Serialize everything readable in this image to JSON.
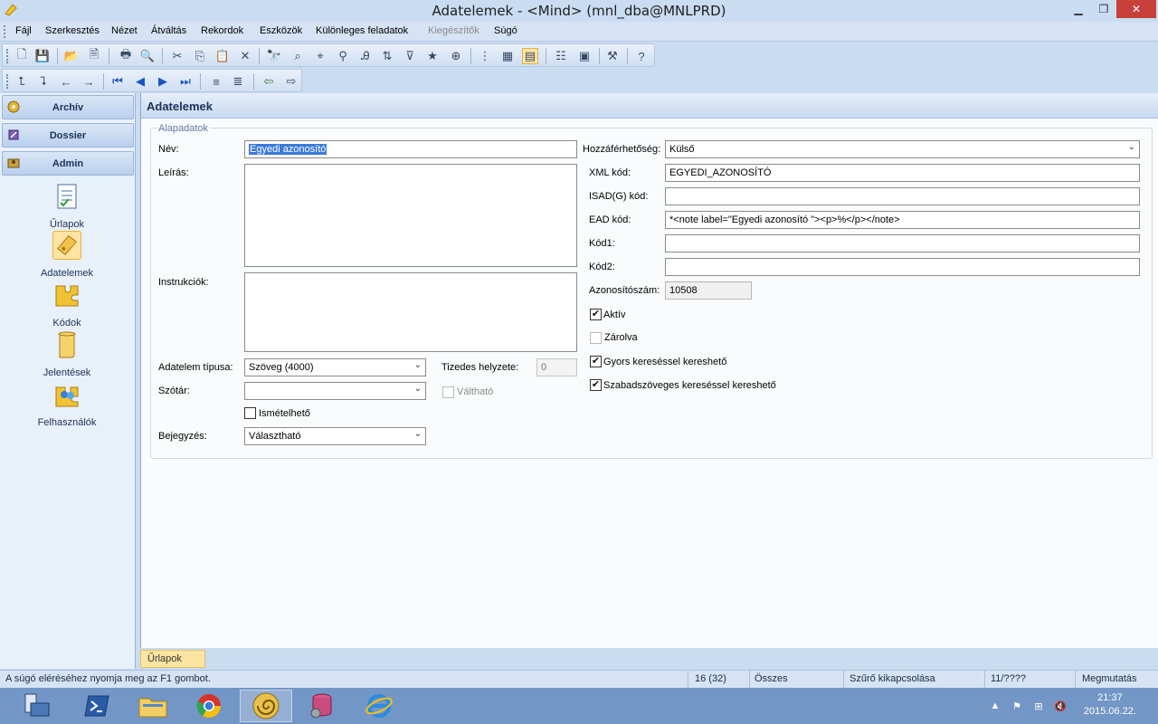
{
  "window": {
    "title": "Adatelemek - <Mind> (mnl_dba@MNLPRD)"
  },
  "menu": [
    "Fájl",
    "Szerkesztés",
    "Nézet",
    "Átváltás",
    "Rekordok",
    "Eszközök",
    "Különleges feladatok",
    "Kiegészítők",
    "Súgó"
  ],
  "nav": {
    "sections": [
      "Archív",
      "Dossier",
      "Admin"
    ],
    "items": [
      "Űrlapok",
      "Adatelemek",
      "Kódok",
      "Jelentések",
      "Felhasználók"
    ],
    "selected": "Adatelemek"
  },
  "main": {
    "header": "Adatelemek",
    "group_label": "Alapadatok",
    "form": {
      "nev_label": "Név:",
      "nev_value": "Egyedi azonosító",
      "leiras_label": "Leírás:",
      "instrukciok_label": "Instrukciók:",
      "tipus_label": "Adatelem típusa:",
      "tipus_value": "Szöveg (4000)",
      "tizedes_label": "Tizedes helyzete:",
      "tizedes_value": "0",
      "szotar_label": "Szótár:",
      "szotar_value": "",
      "valthato_label": "Váltható",
      "ismetelheto_label": "Ismételhető",
      "bejegyzes_label": "Bejegyzés:",
      "bejegyzes_value": "Választható",
      "hozzaferhetoseg_label": "Hozzáférhetőség:",
      "hozzaferhetoseg_value": "Külső",
      "xml_label": "XML kód:",
      "xml_value": "EGYEDI_AZONOSÍTÓ",
      "isad_label": "ISAD(G) kód:",
      "isad_value": "",
      "ead_label": "EAD kód:",
      "ead_value": "*<note label=\"Egyedi azonosító \"><p>%</p></note>",
      "kod1_label": "Kód1:",
      "kod1_value": "",
      "kod2_label": "Kód2:",
      "kod2_value": "",
      "azon_label": "Azonosítószám:",
      "azon_value": "10508",
      "aktiv_label": "Aktív",
      "zarolva_label": "Zárolva",
      "gyors_label": "Gyors kereséssel kereshető",
      "szabad_label": "Szabadszöveges kereséssel kereshető"
    },
    "checks": {
      "aktiv": true,
      "zarolva": false,
      "gyors": true,
      "szabad": true,
      "ismetelheto": false,
      "valthato": false
    }
  },
  "bottom_tab": "Űrlapok",
  "status": {
    "hint": "A súgó eléréséhez nyomja meg az F1 gombot.",
    "count": "16 (32)",
    "scope": "Összes",
    "filter": "Szűrő kikapcsolása",
    "position": "11/????",
    "show": "Megmutatás"
  },
  "clock": {
    "time": "21:37",
    "date": "2015.06.22."
  },
  "colors": {
    "selection": "#3b7ad9",
    "nav_selected": "#fde4a1",
    "close_button": "#c7413a",
    "taskbar": "#7296c6"
  }
}
